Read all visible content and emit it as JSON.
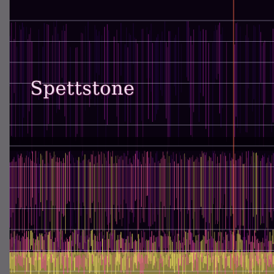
{
  "artwork": {
    "title": "Spettstone",
    "palette": {
      "background": "#0a0210",
      "low": "#2a0650",
      "mid": "#8a1a8a",
      "high": "#e0508a",
      "peak": "#f0e060",
      "margin": "#6a686c",
      "gridline": "#cfc6e6",
      "marker": "#ff6a4a"
    }
  }
}
